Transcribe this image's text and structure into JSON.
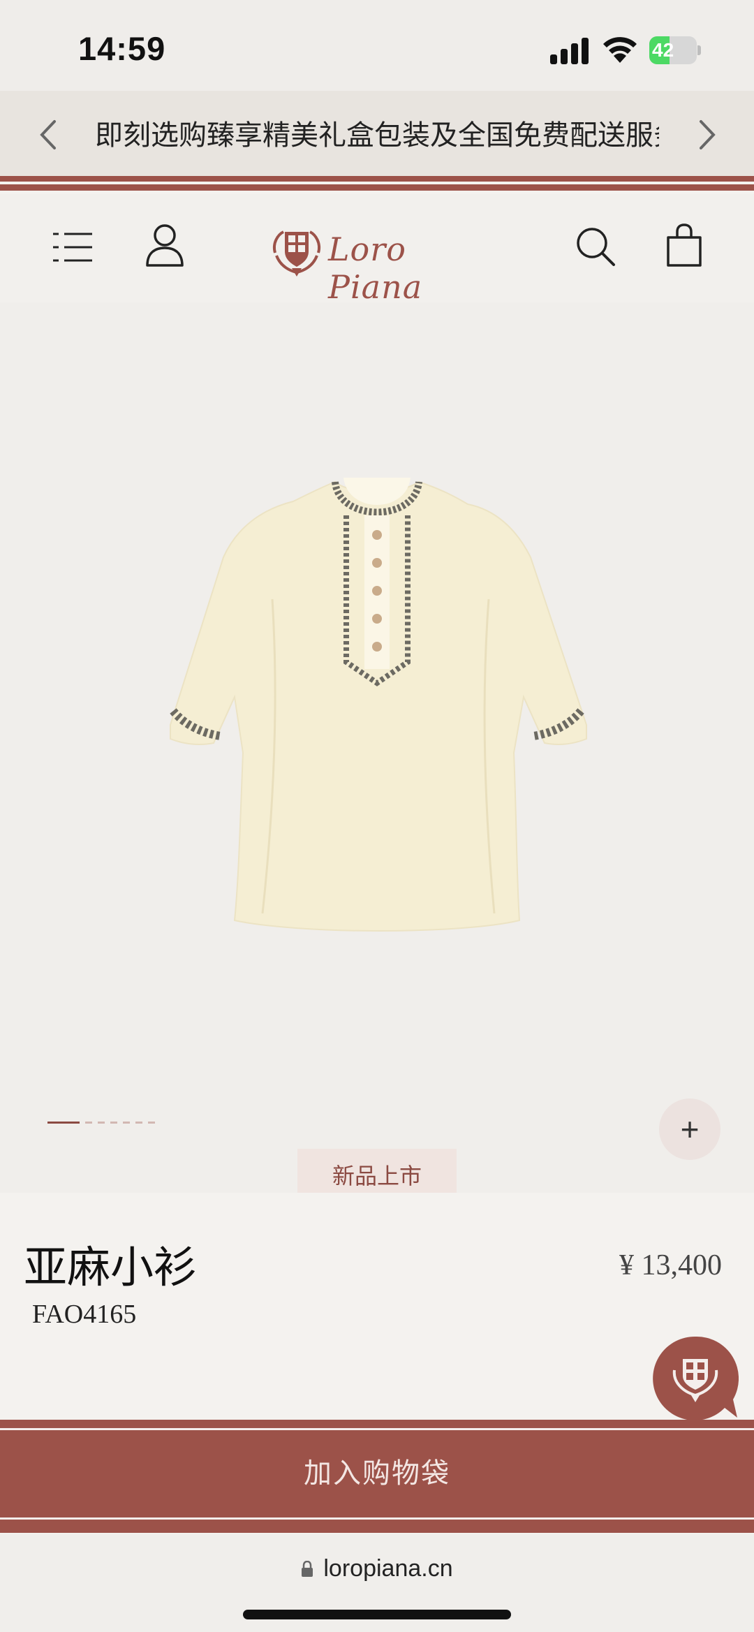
{
  "status_bar": {
    "time": "14:59",
    "battery_level": "42",
    "battery_fraction": 0.42,
    "battery_color": "#4cd964"
  },
  "promo": {
    "text": "即刻选购臻享精美礼盒包装及全国免费配送服务",
    "prev_icon": "chevron-left-icon",
    "next_icon": "chevron-right-icon"
  },
  "header": {
    "brand": "Loro Piana",
    "icons": [
      "menu-icon",
      "account-icon",
      "search-icon",
      "shopping-bag-icon"
    ]
  },
  "product": {
    "image_icon": "linen-blouse-image",
    "carousel_total": 7,
    "carousel_active": 1,
    "badge": "新品上市",
    "title": "亚麻小衫",
    "code": "FAO4165",
    "price": "¥ 13,400"
  },
  "cta": {
    "add_to_bag": "加入购物袋"
  },
  "browser": {
    "url": "loropiana.cn"
  },
  "colors": {
    "brand": "#9c5249",
    "background": "#f4f2ef"
  }
}
